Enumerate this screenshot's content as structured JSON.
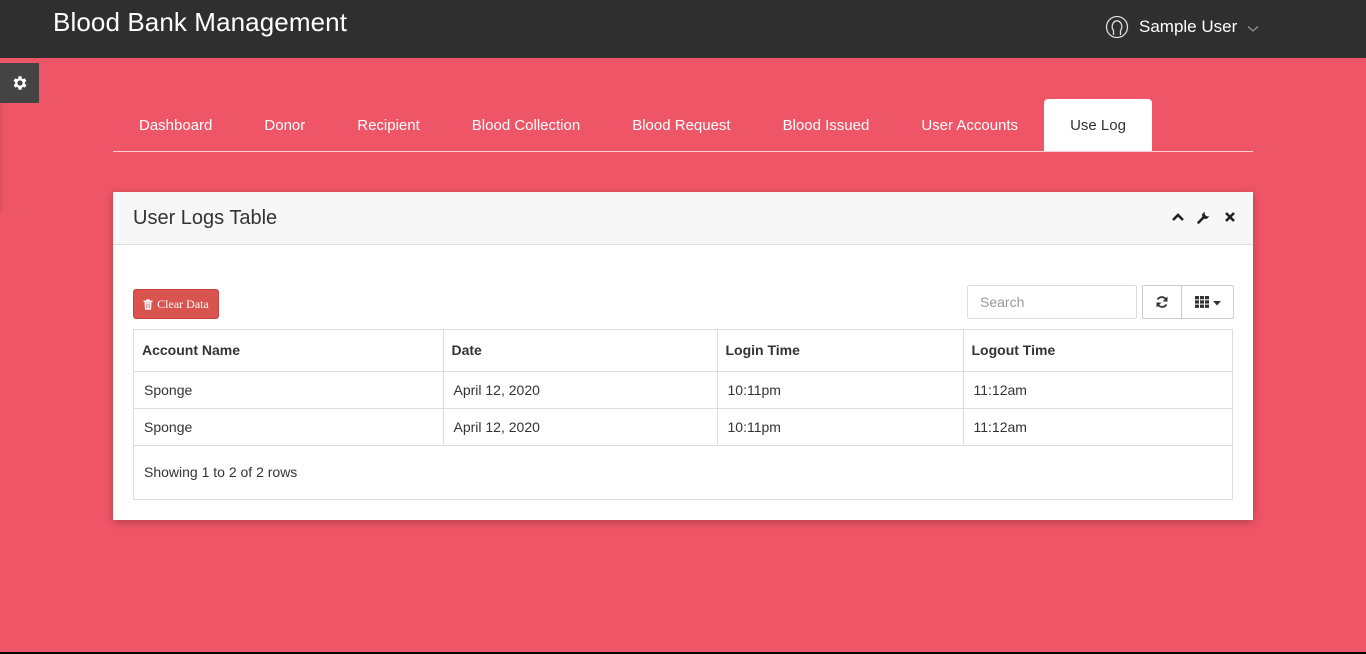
{
  "header": {
    "app_title": "Blood Bank Management",
    "user_name": "Sample User",
    "user_icon": "user-circle-icon",
    "dropdown_icon": "chevron-down-icon"
  },
  "settings": {
    "icon": "gear-icon"
  },
  "nav": {
    "tabs": [
      {
        "label": "Dashboard",
        "active": false
      },
      {
        "label": "Donor",
        "active": false
      },
      {
        "label": "Recipient",
        "active": false
      },
      {
        "label": "Blood Collection",
        "active": false
      },
      {
        "label": "Blood Request",
        "active": false
      },
      {
        "label": "Blood Issued",
        "active": false
      },
      {
        "label": "User Accounts",
        "active": false
      },
      {
        "label": "Use Log",
        "active": true
      }
    ]
  },
  "panel": {
    "title": "User Logs Table",
    "tools": [
      "chevron-up-icon",
      "wrench-icon",
      "close-icon"
    ],
    "clear_button": {
      "label": "Clear Data",
      "icon": "trash-icon",
      "color": "#d9534f"
    },
    "search": {
      "placeholder": "Search",
      "value": ""
    },
    "refresh_icon": "refresh-icon",
    "columns_icon": "grid-icon",
    "table": {
      "columns": [
        "Account Name",
        "Date",
        "Login Time",
        "Logout Time"
      ],
      "rows": [
        [
          "Sponge",
          "April 12, 2020",
          "10:11pm",
          "11:12am"
        ],
        [
          "Sponge",
          "April 12, 2020",
          "10:11pm",
          "11:12am"
        ]
      ],
      "footer": "Showing 1 to 2 of 2 rows"
    }
  },
  "colors": {
    "background": "#ee5566",
    "topbar": "#2f2f2f",
    "danger": "#d9534f"
  }
}
